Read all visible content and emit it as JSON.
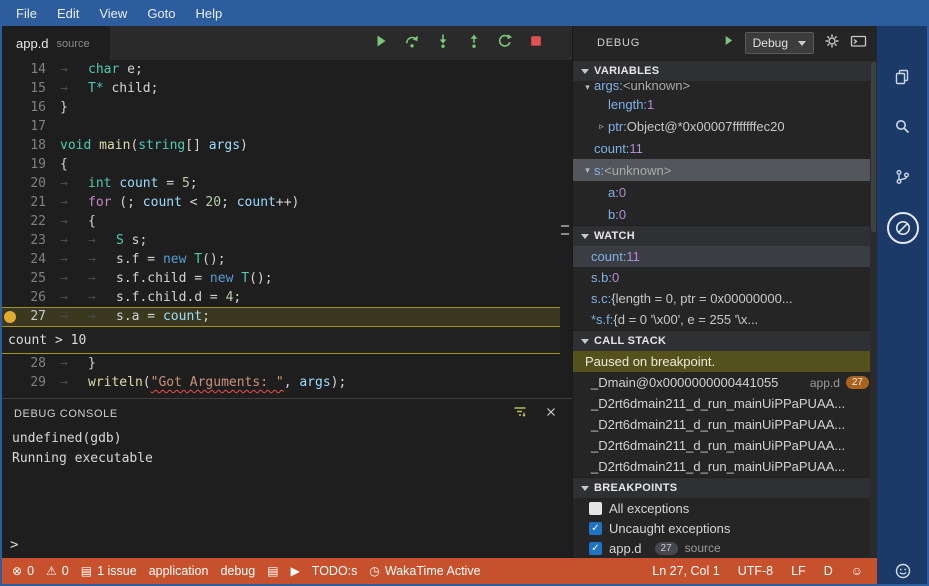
{
  "colors": {
    "accent_blue": "#2e5d9e",
    "status_orange": "#c7512d",
    "activity_navy": "#1c3a68",
    "breakpoint_yellow": "#e0ac2f",
    "paused_olive": "#54511d",
    "debug_green": "#79c879",
    "stop_red": "#e05252",
    "checkbox_blue": "#1f73c5"
  },
  "window": {
    "menu": [
      "File",
      "Edit",
      "View",
      "Goto",
      "Help"
    ]
  },
  "tab": {
    "title": "app.d",
    "description": "source"
  },
  "debug_toolbar": {
    "buttons": [
      "continue",
      "step-over",
      "step-into",
      "step-out",
      "restart",
      "stop"
    ]
  },
  "editor": {
    "lines": [
      {
        "num": 14,
        "segments": [
          {
            "c": "ws",
            "t": "→"
          },
          {
            "c": "type",
            "t": "char"
          },
          {
            "c": "plain",
            "t": " e;"
          }
        ]
      },
      {
        "num": 15,
        "segments": [
          {
            "c": "ws",
            "t": "→"
          },
          {
            "c": "type",
            "t": "T*"
          },
          {
            "c": "plain",
            "t": " child;"
          }
        ]
      },
      {
        "num": 16,
        "segments": [
          {
            "c": "plain",
            "t": "}"
          }
        ]
      },
      {
        "num": 17,
        "segments": []
      },
      {
        "num": 18,
        "segments": [
          {
            "c": "kw",
            "t": "void"
          },
          {
            "c": "plain",
            "t": " "
          },
          {
            "c": "func",
            "t": "main"
          },
          {
            "c": "plain",
            "t": "("
          },
          {
            "c": "type",
            "t": "string"
          },
          {
            "c": "plain",
            "t": "[] "
          },
          {
            "c": "var",
            "t": "args"
          },
          {
            "c": "plain",
            "t": ")"
          }
        ]
      },
      {
        "num": 19,
        "segments": [
          {
            "c": "plain",
            "t": "{"
          }
        ]
      },
      {
        "num": 20,
        "segments": [
          {
            "c": "ws",
            "t": "→"
          },
          {
            "c": "kw",
            "t": "int"
          },
          {
            "c": "plain",
            "t": " "
          },
          {
            "c": "var",
            "t": "count"
          },
          {
            "c": "plain",
            "t": " = "
          },
          {
            "c": "num",
            "t": "5"
          },
          {
            "c": "plain",
            "t": ";"
          }
        ]
      },
      {
        "num": 21,
        "segments": [
          {
            "c": "ws",
            "t": "→"
          },
          {
            "c": "ctrl",
            "t": "for"
          },
          {
            "c": "plain",
            "t": " (; "
          },
          {
            "c": "var",
            "t": "count"
          },
          {
            "c": "plain",
            "t": " < "
          },
          {
            "c": "num",
            "t": "20"
          },
          {
            "c": "plain",
            "t": "; "
          },
          {
            "c": "var",
            "t": "count"
          },
          {
            "c": "plain",
            "t": "++)"
          }
        ]
      },
      {
        "num": 22,
        "segments": [
          {
            "c": "ws",
            "t": "→"
          },
          {
            "c": "plain",
            "t": "{"
          }
        ]
      },
      {
        "num": 23,
        "segments": [
          {
            "c": "ws",
            "t": "→"
          },
          {
            "c": "ws",
            "t": "→"
          },
          {
            "c": "type",
            "t": "S"
          },
          {
            "c": "plain",
            "t": " s;"
          }
        ]
      },
      {
        "num": 24,
        "segments": [
          {
            "c": "ws",
            "t": "→"
          },
          {
            "c": "ws",
            "t": "→"
          },
          {
            "c": "plain",
            "t": "s.f = "
          },
          {
            "c": "kwnew",
            "t": "new"
          },
          {
            "c": "plain",
            "t": " "
          },
          {
            "c": "type",
            "t": "T"
          },
          {
            "c": "plain",
            "t": "();"
          }
        ]
      },
      {
        "num": 25,
        "segments": [
          {
            "c": "ws",
            "t": "→"
          },
          {
            "c": "ws",
            "t": "→"
          },
          {
            "c": "plain",
            "t": "s.f.child = "
          },
          {
            "c": "kwnew",
            "t": "new"
          },
          {
            "c": "plain",
            "t": " "
          },
          {
            "c": "type",
            "t": "T"
          },
          {
            "c": "plain",
            "t": "();"
          }
        ]
      },
      {
        "num": 26,
        "segments": [
          {
            "c": "ws",
            "t": "→"
          },
          {
            "c": "ws",
            "t": "→"
          },
          {
            "c": "plain",
            "t": "s.f.child.d = "
          },
          {
            "c": "num",
            "t": "4"
          },
          {
            "c": "plain",
            "t": ";"
          }
        ]
      },
      {
        "num": 27,
        "current": true,
        "breakpoint": true,
        "peek": true,
        "segments": [
          {
            "c": "ws",
            "t": "→"
          },
          {
            "c": "ws",
            "t": "→"
          },
          {
            "c": "plain",
            "t": "s.a = "
          },
          {
            "c": "var",
            "t": "count"
          },
          {
            "c": "plain",
            "t": ";"
          }
        ]
      },
      {
        "num": 28,
        "segments": [
          {
            "c": "ws",
            "t": "→"
          },
          {
            "c": "plain",
            "t": "}"
          }
        ]
      },
      {
        "num": 29,
        "segments": [
          {
            "c": "ws",
            "t": "→"
          },
          {
            "c": "func",
            "t": "writeln"
          },
          {
            "c": "plain",
            "t": "("
          },
          {
            "c": "str",
            "t": "\"Got Arguments: \""
          },
          {
            "c": "plain",
            "t": ", "
          },
          {
            "c": "var",
            "t": "args"
          },
          {
            "c": "plain",
            "t": ");"
          }
        ]
      }
    ],
    "peek": {
      "text": "count > 10"
    }
  },
  "debug_console": {
    "title": "DEBUG CONSOLE",
    "lines": [
      "undefined(gdb)",
      "Running executable"
    ],
    "prompt": ">"
  },
  "debug_panel": {
    "title": "DEBUG",
    "config": "Debug",
    "variables": {
      "title": "VARIABLES",
      "rows": [
        {
          "name": "args",
          "value": "<unknown>",
          "vtype": "muted",
          "indent": 0,
          "arrow": "expanded",
          "clipped": true
        },
        {
          "name": "length",
          "value": "1",
          "vtype": "num",
          "indent": 1
        },
        {
          "name": "ptr",
          "value": "Object@*0x00007fffffffec20",
          "vtype": "raw",
          "indent": 1,
          "arrow": "collapsed"
        },
        {
          "name": "count",
          "value": "11",
          "vtype": "num",
          "indent": 0
        },
        {
          "name": "s",
          "value": "<unknown>",
          "vtype": "muted",
          "indent": 0,
          "arrow": "expanded",
          "selected": true
        },
        {
          "name": "a",
          "value": "0",
          "vtype": "num",
          "indent": 1
        },
        {
          "name": "b",
          "value": "0",
          "vtype": "num",
          "indent": 1
        }
      ]
    },
    "watch": {
      "title": "WATCH",
      "rows": [
        {
          "name": "count",
          "value": "11",
          "vtype": "num",
          "selected": true
        },
        {
          "name": "s.b",
          "value": "0",
          "vtype": "num"
        },
        {
          "name": "s.c",
          "value": "{length = 0, ptr = 0x00000000...",
          "vtype": "raw"
        },
        {
          "name": "*s.f",
          "value": "{d = 0 '\\x00', e = 255 '\\x...",
          "vtype": "raw"
        }
      ]
    },
    "call_stack": {
      "title": "CALL STACK",
      "status": "Paused on breakpoint.",
      "frames": [
        {
          "name": "_Dmain@0x0000000000441055",
          "file": "app.d",
          "line": "27"
        },
        {
          "name": "_D2rt6dmain211_d_run_mainUiPPaPUAA..."
        },
        {
          "name": "_D2rt6dmain211_d_run_mainUiPPaPUAA..."
        },
        {
          "name": "_D2rt6dmain211_d_run_mainUiPPaPUAA..."
        },
        {
          "name": "_D2rt6dmain211_d_run_mainUiPPaPUAA..."
        }
      ]
    },
    "breakpoints": {
      "title": "BREAKPOINTS",
      "rows": [
        {
          "checked": false,
          "label": "All exceptions"
        },
        {
          "checked": true,
          "label": "Uncaught exceptions"
        },
        {
          "checked": true,
          "label": "app.d",
          "badge": "27",
          "detail": "source"
        }
      ]
    }
  },
  "activity_bar": {
    "icons": [
      "files",
      "search",
      "source-control",
      "debug-no-symbols",
      "feedback-smiley"
    ]
  },
  "status_bar": {
    "left": [
      {
        "icon": "error-circle",
        "text": "0"
      },
      {
        "icon": "warning",
        "text": "0"
      },
      {
        "icon": "issues",
        "text": "1 issue"
      },
      {
        "text": "application"
      },
      {
        "text": "debug"
      },
      {
        "icon": "file-report",
        "text": ""
      },
      {
        "icon": "play-small",
        "text": ""
      },
      {
        "text": "TODO:s"
      },
      {
        "icon": "clock",
        "text": "WakaTime Active"
      }
    ],
    "right": [
      {
        "text": "Ln 27, Col 1"
      },
      {
        "text": "UTF-8"
      },
      {
        "text": "LF"
      },
      {
        "text": "D"
      },
      {
        "icon": "smiley",
        "text": ""
      }
    ]
  }
}
